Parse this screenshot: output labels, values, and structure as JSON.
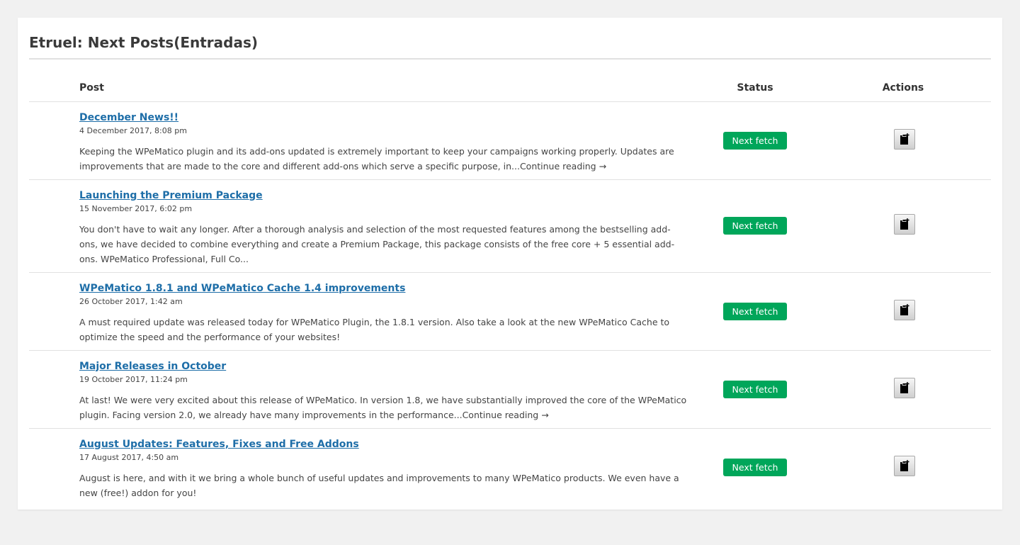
{
  "page": {
    "title": "Etruel: Next Posts(Entradas)"
  },
  "table": {
    "headers": {
      "post": "Post",
      "status": "Status",
      "actions": "Actions"
    },
    "rows": [
      {
        "title": "December News!!",
        "date": "4 December 2017, 8:08 pm",
        "excerpt": "Keeping the WPeMatico plugin and its add-ons updated is extremely important to keep your campaigns working properly. Updates are improvements that are made to the core and different add-ons which serve a specific purpose, in...Continue reading →",
        "status": "Next fetch",
        "action_icon": "clipboard-add-icon"
      },
      {
        "title": "Launching the Premium Package",
        "date": "15 November 2017, 6:02 pm",
        "excerpt": "You don't have to wait any longer. After a thorough analysis and selection of the most requested features among the bestselling add-ons, we have decided to combine everything and create a Premium Package, this package consists of the free core + 5 essential add-ons. WPeMatico Professional, Full Co...",
        "status": "Next fetch",
        "action_icon": "clipboard-add-icon"
      },
      {
        "title": "WPeMatico 1.8.1 and WPeMatico Cache 1.4 improvements",
        "date": "26 October 2017, 1:42 am",
        "excerpt": "A must required update was released today for WPeMatico Plugin, the 1.8.1 version. Also take a look at the new WPeMatico Cache to optimize the speed and the performance of your websites!",
        "status": "Next fetch",
        "action_icon": "clipboard-add-icon"
      },
      {
        "title": "Major Releases in October",
        "date": "19 October 2017, 11:24 pm",
        "excerpt": "At last! We were very excited about this release of WPeMatico. In version 1.8, we have substantially improved the core of the WPeMatico plugin. Facing  version 2.0, we already have many improvements in the performance...Continue reading →",
        "status": "Next fetch",
        "action_icon": "clipboard-add-icon"
      },
      {
        "title": "August Updates: Features, Fixes and Free Addons",
        "date": "17 August 2017, 4:50 am",
        "excerpt": "August is here, and with it we bring a whole bunch of useful updates and improvements to many WPeMatico products. We even have a new (free!) addon for you!",
        "status": "Next fetch",
        "action_icon": "clipboard-add-icon"
      }
    ]
  },
  "colors": {
    "badge": "#00a65a",
    "link": "#1e6ea8"
  }
}
